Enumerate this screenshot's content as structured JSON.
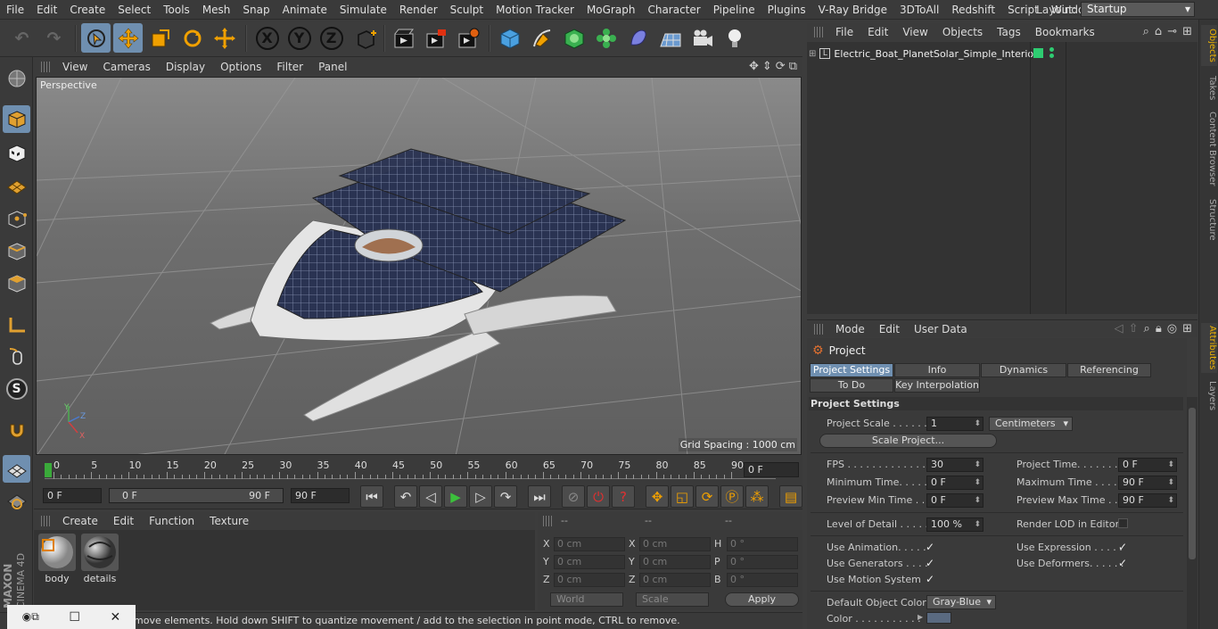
{
  "menubar": {
    "items": [
      "File",
      "Edit",
      "Create",
      "Select",
      "Tools",
      "Mesh",
      "Snap",
      "Animate",
      "Simulate",
      "Render",
      "Sculpt",
      "Motion Tracker",
      "MoGraph",
      "Character",
      "Pipeline",
      "Plugins",
      "V-Ray Bridge",
      "3DToAll",
      "Redshift",
      "Script",
      "Window",
      "Help"
    ],
    "layout_label": "Layout:",
    "layout_value": "Startup"
  },
  "toolbar": {
    "axis_x": "X",
    "axis_y": "Y",
    "axis_z": "Z"
  },
  "leftbar": {
    "snap_letter": "S",
    "brand_maxon": "MAXON",
    "brand_c4d": "CINEMA 4D"
  },
  "viewport": {
    "menu": [
      "View",
      "Cameras",
      "Display",
      "Options",
      "Filter",
      "Panel"
    ],
    "label": "Perspective",
    "grid_spacing": "Grid Spacing : 1000 cm",
    "axis_labels": {
      "y": "Y",
      "z": "Z",
      "x": "X"
    }
  },
  "timeline": {
    "ticks": [
      "0",
      "5",
      "10",
      "15",
      "20",
      "25",
      "30",
      "35",
      "40",
      "45",
      "50",
      "55",
      "60",
      "65",
      "70",
      "75",
      "80",
      "85",
      "90"
    ],
    "current_frame": "0 F"
  },
  "transport": {
    "start_frame": "0 F",
    "range_start": "0 F",
    "range_end": "90 F",
    "end_frame": "90 F"
  },
  "materials": {
    "menu": [
      "Create",
      "Edit",
      "Function",
      "Texture"
    ],
    "items": [
      {
        "name": "body"
      },
      {
        "name": "details"
      }
    ]
  },
  "coordinates": {
    "headers": [
      "--",
      "--",
      "--"
    ],
    "rows": [
      {
        "a": "X",
        "av": "0 cm",
        "b": "X",
        "bv": "0 cm",
        "c": "H",
        "cv": "0 °"
      },
      {
        "a": "Y",
        "av": "0 cm",
        "b": "Y",
        "bv": "0 cm",
        "c": "P",
        "cv": "0 °"
      },
      {
        "a": "Z",
        "av": "0 cm",
        "b": "Z",
        "bv": "0 cm",
        "c": "B",
        "cv": "0 °"
      }
    ],
    "mode_world": "World",
    "mode_scale": "Scale",
    "apply_label": "Apply"
  },
  "status": {
    "text": "move elements. Hold down SHIFT to quantize movement / add to the selection in point mode, CTRL to remove."
  },
  "objects": {
    "menu": [
      "File",
      "Edit",
      "View",
      "Objects",
      "Tags",
      "Bookmarks"
    ],
    "items": [
      {
        "name": "Electric_Boat_PlanetSolar_Simple_Interior"
      }
    ],
    "tag_color": "#2ecc71"
  },
  "side_tabs": {
    "top": [
      "Objects",
      "Takes",
      "Content Browser",
      "Structure"
    ],
    "bottom": [
      "Attributes",
      "Layers"
    ]
  },
  "attributes": {
    "menu": [
      "Mode",
      "Edit",
      "User Data"
    ],
    "title": "Project",
    "tabs_row1": [
      "Project Settings",
      "Info",
      "Dynamics",
      "Referencing"
    ],
    "tabs_row2": [
      "To Do",
      "Key Interpolation"
    ],
    "section": "Project Settings",
    "project_scale_label": "Project Scale . . . . . .",
    "project_scale_value": "1",
    "project_scale_unit": "Centimeters",
    "scale_project_button": "Scale Project...",
    "fps_label": "FPS . . . . . . . . . . . . . .",
    "fps_value": "30",
    "project_time_label": "Project Time. . . . . . .",
    "project_time_value": "0 F",
    "min_time_label": "Minimum Time. . . . .",
    "min_time_value": "0 F",
    "max_time_label": "Maximum Time . . . . .",
    "max_time_value": "90 F",
    "preview_min_label": "Preview Min Time . .",
    "preview_min_value": "0 F",
    "preview_max_label": "Preview Max Time . .",
    "preview_max_value": "90 F",
    "lod_label": "Level of Detail . . . . .",
    "lod_value": "100 %",
    "render_lod_label": "Render LOD in Editor",
    "use_animation_label": "Use Animation. . . . .",
    "use_expression_label": "Use Expression . . . . .",
    "use_generators_label": "Use Generators . . . .",
    "use_deformers_label": "Use Deformers. . . . . .",
    "use_motion_label": "Use Motion System",
    "default_color_label": "Default Object Color",
    "default_color_value": "Gray-Blue",
    "color_label": "Color . . . . . . . . . . .",
    "color_swatch": "#5a6a80",
    "check_mark": "✓"
  },
  "colors": {
    "accent": "#6f8fb0",
    "orange": "#f0a000"
  }
}
